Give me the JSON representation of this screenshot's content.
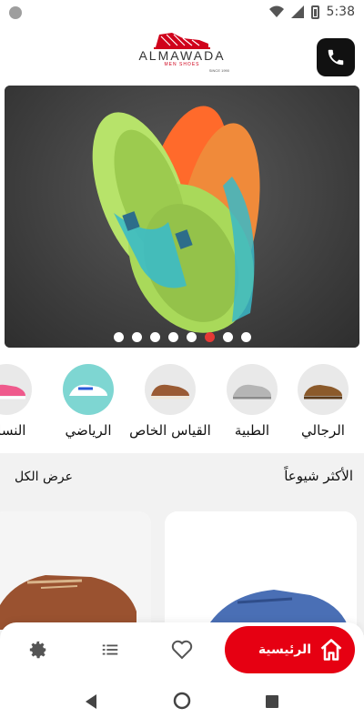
{
  "status": {
    "time": "5:38"
  },
  "header": {
    "brand": "ALMAWADA",
    "tagline": "MEN SHOES",
    "since": "SINCE 1990"
  },
  "banner": {
    "slides": 8,
    "active_slide": 6
  },
  "categories": [
    {
      "label": "الرجالي",
      "icon": "brown-loafer-thumb"
    },
    {
      "label": "الطبية",
      "icon": "grey-knit-shoe-thumb"
    },
    {
      "label": "القياس الخاص",
      "icon": "brown-boat-shoe-thumb"
    },
    {
      "label": "الرياضي",
      "icon": "sport-shoe-thumb"
    },
    {
      "label": "النسائ",
      "icon": "pink-sneaker-thumb"
    }
  ],
  "section": {
    "title": "الأكثر شيوعاً",
    "view_all": "عرض الكل"
  },
  "bottom_nav": {
    "home_label": "الرئيسية",
    "items": [
      "settings-icon",
      "list-icon",
      "heart-icon",
      "home-icon"
    ]
  },
  "colors": {
    "accent": "#e60012",
    "call_button": "#111111",
    "active_dot": "#e53935"
  }
}
